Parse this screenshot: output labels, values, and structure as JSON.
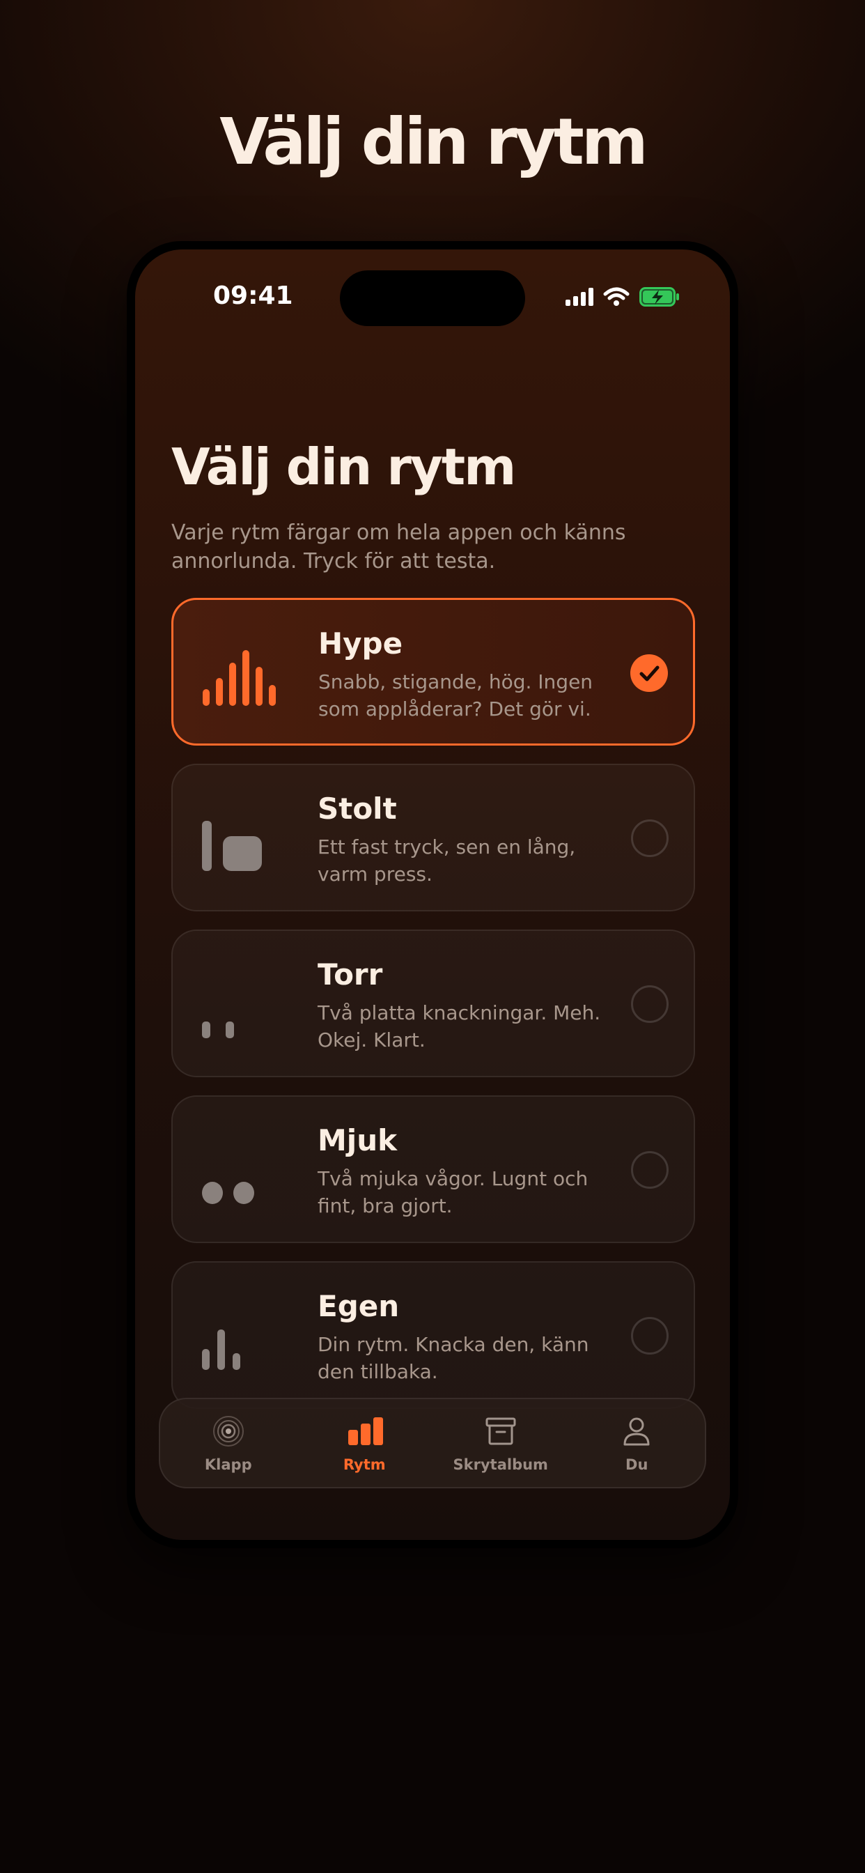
{
  "hero_title": "Välj din rytm",
  "status": {
    "time": "09:41"
  },
  "screen": {
    "title": "Välj din rytm",
    "subtitle": "Varje rytm färgar om hela appen och känns annorlunda. Tryck för att testa."
  },
  "rhythms": [
    {
      "name": "Hype",
      "desc": "Snabb, stigande, hög. Ingen som applåderar? Det gör vi.",
      "selected": true,
      "icon": "rising-bars-icon"
    },
    {
      "name": "Stolt",
      "desc": "Ett fast tryck, sen en lång, varm press.",
      "selected": false,
      "icon": "tap-press-icon"
    },
    {
      "name": "Torr",
      "desc": "Två platta knackningar. Meh. Okej. Klart.",
      "selected": false,
      "icon": "two-flat-taps-icon"
    },
    {
      "name": "Mjuk",
      "desc": "Två mjuka vågor. Lugnt och fint, bra gjort.",
      "selected": false,
      "icon": "two-soft-dots-icon"
    },
    {
      "name": "Egen",
      "desc": "Din rytm. Knacka den, känn den tillbaka.",
      "selected": false,
      "icon": "custom-bars-icon"
    }
  ],
  "tabs": [
    {
      "label": "Klapp",
      "icon": "ripple-icon",
      "active": false
    },
    {
      "label": "Rytm",
      "icon": "bars-icon",
      "active": true
    },
    {
      "label": "Skrytalbum",
      "icon": "archive-box-icon",
      "active": false
    },
    {
      "label": "Du",
      "icon": "person-icon",
      "active": false
    }
  ],
  "colors": {
    "accent": "#ff6a2b",
    "battery": "#34c759",
    "text": "#fbeee2",
    "muted": "#a8978c"
  }
}
